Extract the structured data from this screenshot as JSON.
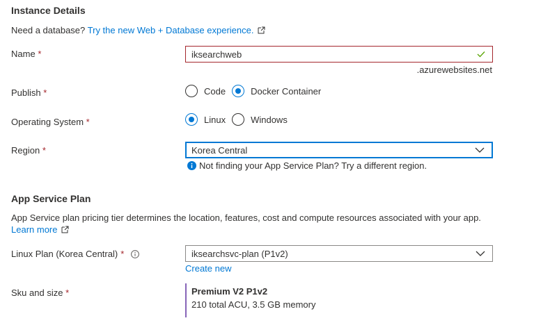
{
  "instance_details": {
    "title": "Instance Details",
    "db_prompt": "Need a database?",
    "db_link": "Try the new Web + Database experience.",
    "name": {
      "label": "Name",
      "value": "iksearchweb",
      "suffix": ".azurewebsites.net"
    },
    "publish": {
      "label": "Publish",
      "options": [
        "Code",
        "Docker Container"
      ],
      "selected": "Docker Container"
    },
    "os": {
      "label": "Operating System",
      "options": [
        "Linux",
        "Windows"
      ],
      "selected": "Linux"
    },
    "region": {
      "label": "Region",
      "value": "Korea Central",
      "hint": "Not finding your App Service Plan? Try a different region."
    }
  },
  "app_service_plan": {
    "title": "App Service Plan",
    "description": "App Service plan pricing tier determines the location, features, cost and compute resources associated with your app.",
    "learn_more": "Learn more",
    "plan": {
      "label": "Linux Plan (Korea Central)",
      "value": "iksearchsvc-plan (P1v2)",
      "create_new": "Create new"
    },
    "sku": {
      "label": "Sku and size",
      "name": "Premium V2 P1v2",
      "details": "210 total ACU, 3.5 GB memory"
    }
  },
  "required_marker": "*",
  "colors": {
    "accent": "#0078d4",
    "valid": "#57a300",
    "error": "#a4262c",
    "sku_border": "#8764b8"
  }
}
